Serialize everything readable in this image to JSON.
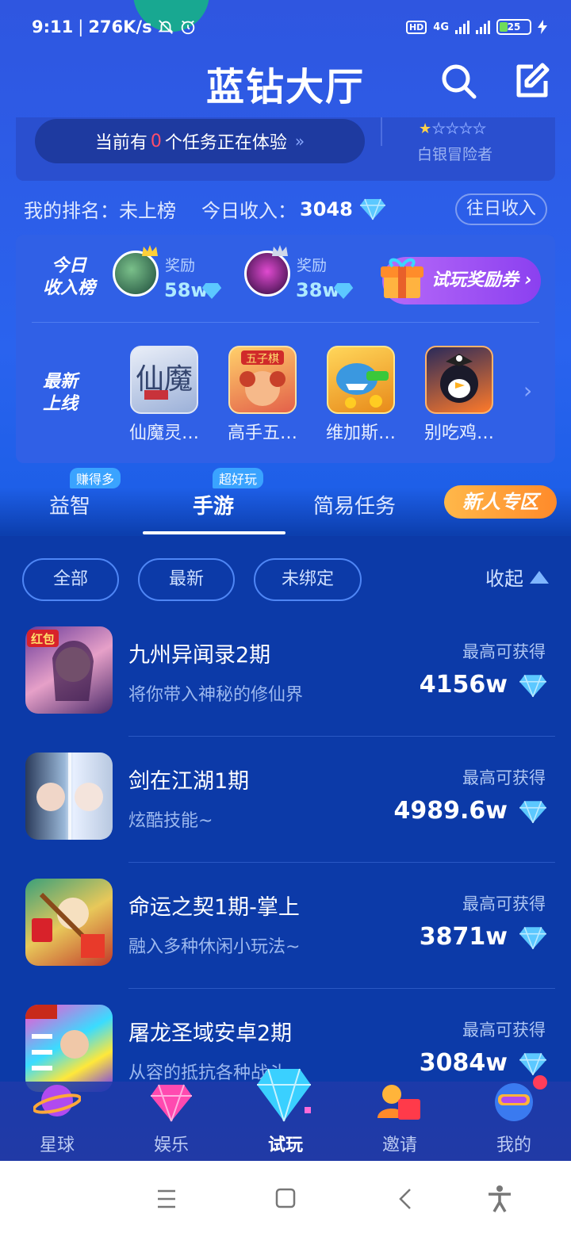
{
  "status_bar": {
    "time": "9:11",
    "speed": "276K/s",
    "hd": "HD",
    "network": "4G",
    "battery": "25",
    "icons": [
      "bell-off-icon",
      "alarm-icon",
      "signal-icon",
      "battery-icon",
      "charging-icon"
    ]
  },
  "header": {
    "title": "蓝钻大厅",
    "icons": [
      "search-icon",
      "edit-icon"
    ]
  },
  "task_card": {
    "prefix": "当前有",
    "count": "0",
    "suffix": "个任务正在体验",
    "chevron": "»",
    "stars_filled": 1,
    "stars_total": 5,
    "rank_title": "白银冒险者"
  },
  "stats": {
    "rank_label": "我的排名：",
    "rank_value": "未上榜",
    "income_label": "今日收入：",
    "income_value": "3048",
    "past_income_button": "往日收入"
  },
  "board": {
    "income_tag_line1": "今日",
    "income_tag_line2": "收入榜",
    "rewards": [
      {
        "label": "奖励",
        "value": "58w"
      },
      {
        "label": "奖励",
        "value": "38w"
      }
    ],
    "coupon_label": "试玩奖励券",
    "new_tag_line1": "最新",
    "new_tag_line2": "上线",
    "games": [
      {
        "name": "仙魔灵…"
      },
      {
        "name": "高手五…"
      },
      {
        "name": "维加斯…"
      },
      {
        "name": "别吃鸡…"
      }
    ]
  },
  "tabs": {
    "items": [
      {
        "label": "益智",
        "badge": "赚得多"
      },
      {
        "label": "手游",
        "badge": "超好玩"
      },
      {
        "label": "简易任务",
        "badge": ""
      }
    ],
    "active_index": 1,
    "newbie_button": "新人专区"
  },
  "filters": {
    "items": [
      "全部",
      "最新",
      "未绑定"
    ],
    "collapse_label": "收起"
  },
  "games": [
    {
      "name": "九州异闻录2期",
      "desc": "将你带入神秘的修仙界",
      "hint": "最高可获得",
      "amount": "4156w"
    },
    {
      "name": "剑在江湖1期",
      "desc": "炫酷技能~",
      "hint": "最高可获得",
      "amount": "4989.6w"
    },
    {
      "name": "命运之契1期-掌上",
      "desc": "融入多种休闲小玩法~",
      "hint": "最高可获得",
      "amount": "3871w"
    },
    {
      "name": "屠龙圣域安卓2期",
      "desc": "从容的抵抗各种战斗",
      "hint": "最高可获得",
      "amount": "3084w"
    }
  ],
  "bottom_nav": {
    "items": [
      {
        "label": "星球",
        "icon": "planet-icon"
      },
      {
        "label": "娱乐",
        "icon": "gem-icon"
      },
      {
        "label": "试玩",
        "icon": "diamond-icon"
      },
      {
        "label": "邀请",
        "icon": "invite-icon"
      },
      {
        "label": "我的",
        "icon": "profile-icon"
      }
    ],
    "active_index": 2
  },
  "system_nav": [
    "menu-icon",
    "home-icon",
    "back-icon",
    "accessibility-icon"
  ],
  "colors": {
    "accent": "#2f56e0",
    "list_bg": "#0c3aa8",
    "zero_highlight": "#ff4d6a",
    "newbie": "#ff8a2a"
  }
}
